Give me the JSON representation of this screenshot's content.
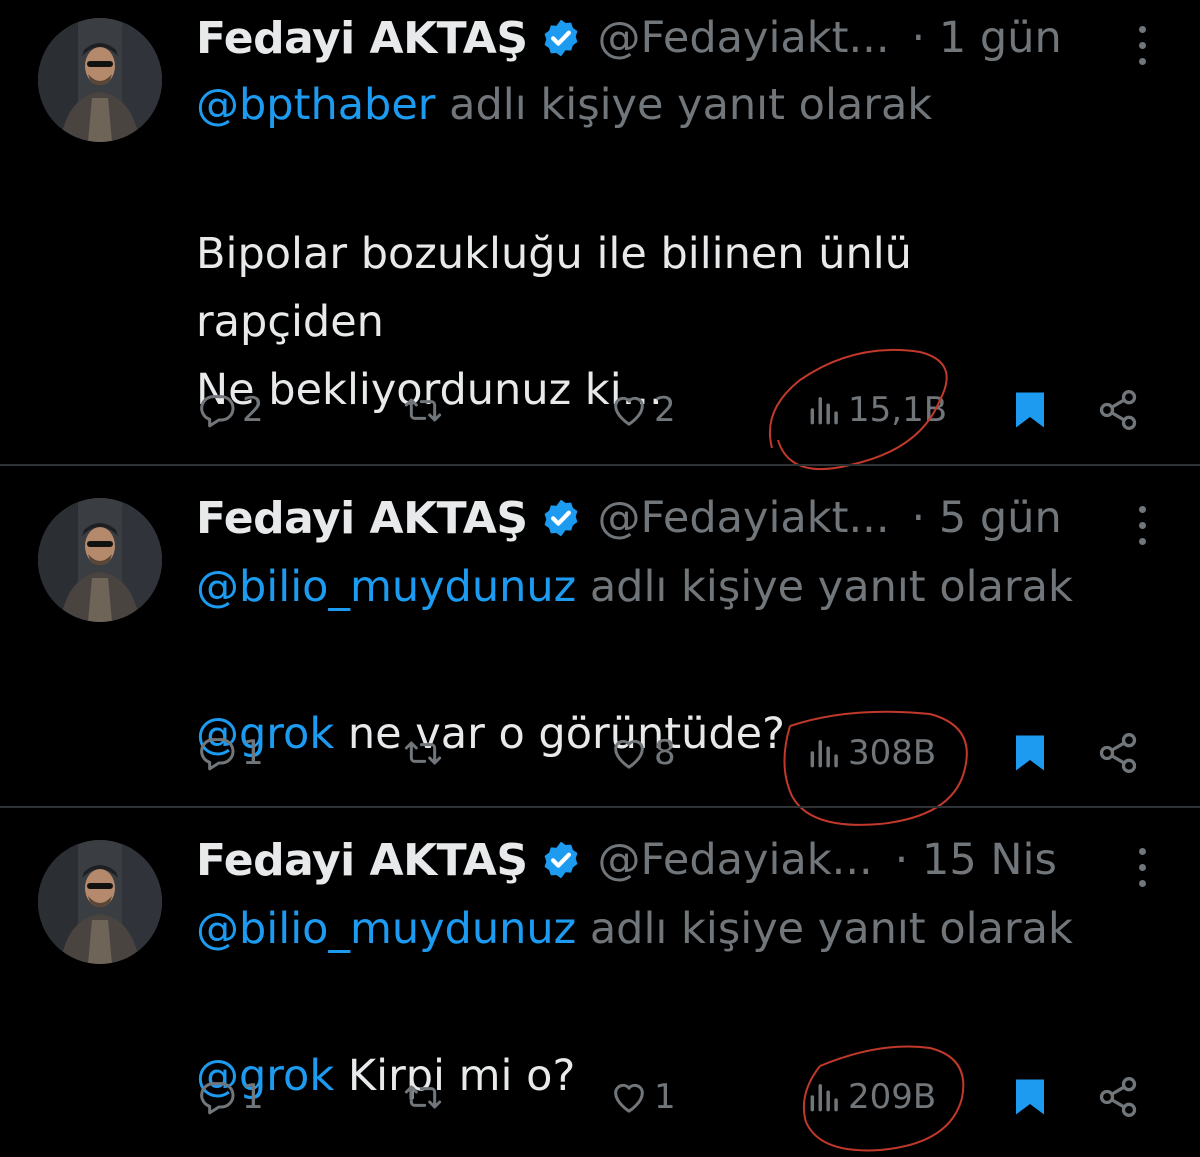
{
  "tweets": [
    {
      "name": "Fedayi AKTAŞ",
      "handle": "@Fedayiakt...",
      "time": "· 1 gün",
      "reply_to": "@bpthaber",
      "reply_suffix": " adlı kişiye yanıt olarak",
      "text_mention": "",
      "text": "Bipolar bozukluğu ile bilinen ünlü\nrapçiden\nNe bekliyordunuz ki...",
      "replies": "2",
      "retweets": "",
      "likes": "2",
      "views": "15,1B",
      "bookmarked": true
    },
    {
      "name": "Fedayi AKTAŞ",
      "handle": "@Fedayiakt...",
      "time": "· 5 gün",
      "reply_to": "@bilio_muydunuz",
      "reply_suffix": " adlı kişiye yanıt olarak",
      "text_mention": "@grok",
      "text": " ne var o görüntüde?",
      "replies": "1",
      "retweets": "",
      "likes": "8",
      "views": "308B",
      "bookmarked": true
    },
    {
      "name": "Fedayi AKTAŞ",
      "handle": "@Fedayiak...",
      "time": "· 15 Nis",
      "reply_to": "@bilio_muydunuz",
      "reply_suffix": " adlı kişiye yanıt olarak",
      "text_mention": "@grok",
      "text": " Kirpi mi o?",
      "replies": "1",
      "retweets": "",
      "likes": "1",
      "views": "209B",
      "bookmarked": true
    }
  ],
  "colors": {
    "background": "#000000",
    "text": "#e7e9ea",
    "muted": "#71767b",
    "accent": "#1d9bf0",
    "annotation": "#c0392b"
  },
  "icons": [
    "verified-badge-icon",
    "more-icon",
    "reply-icon",
    "retweet-icon",
    "like-icon",
    "views-icon",
    "bookmark-icon",
    "share-icon"
  ]
}
